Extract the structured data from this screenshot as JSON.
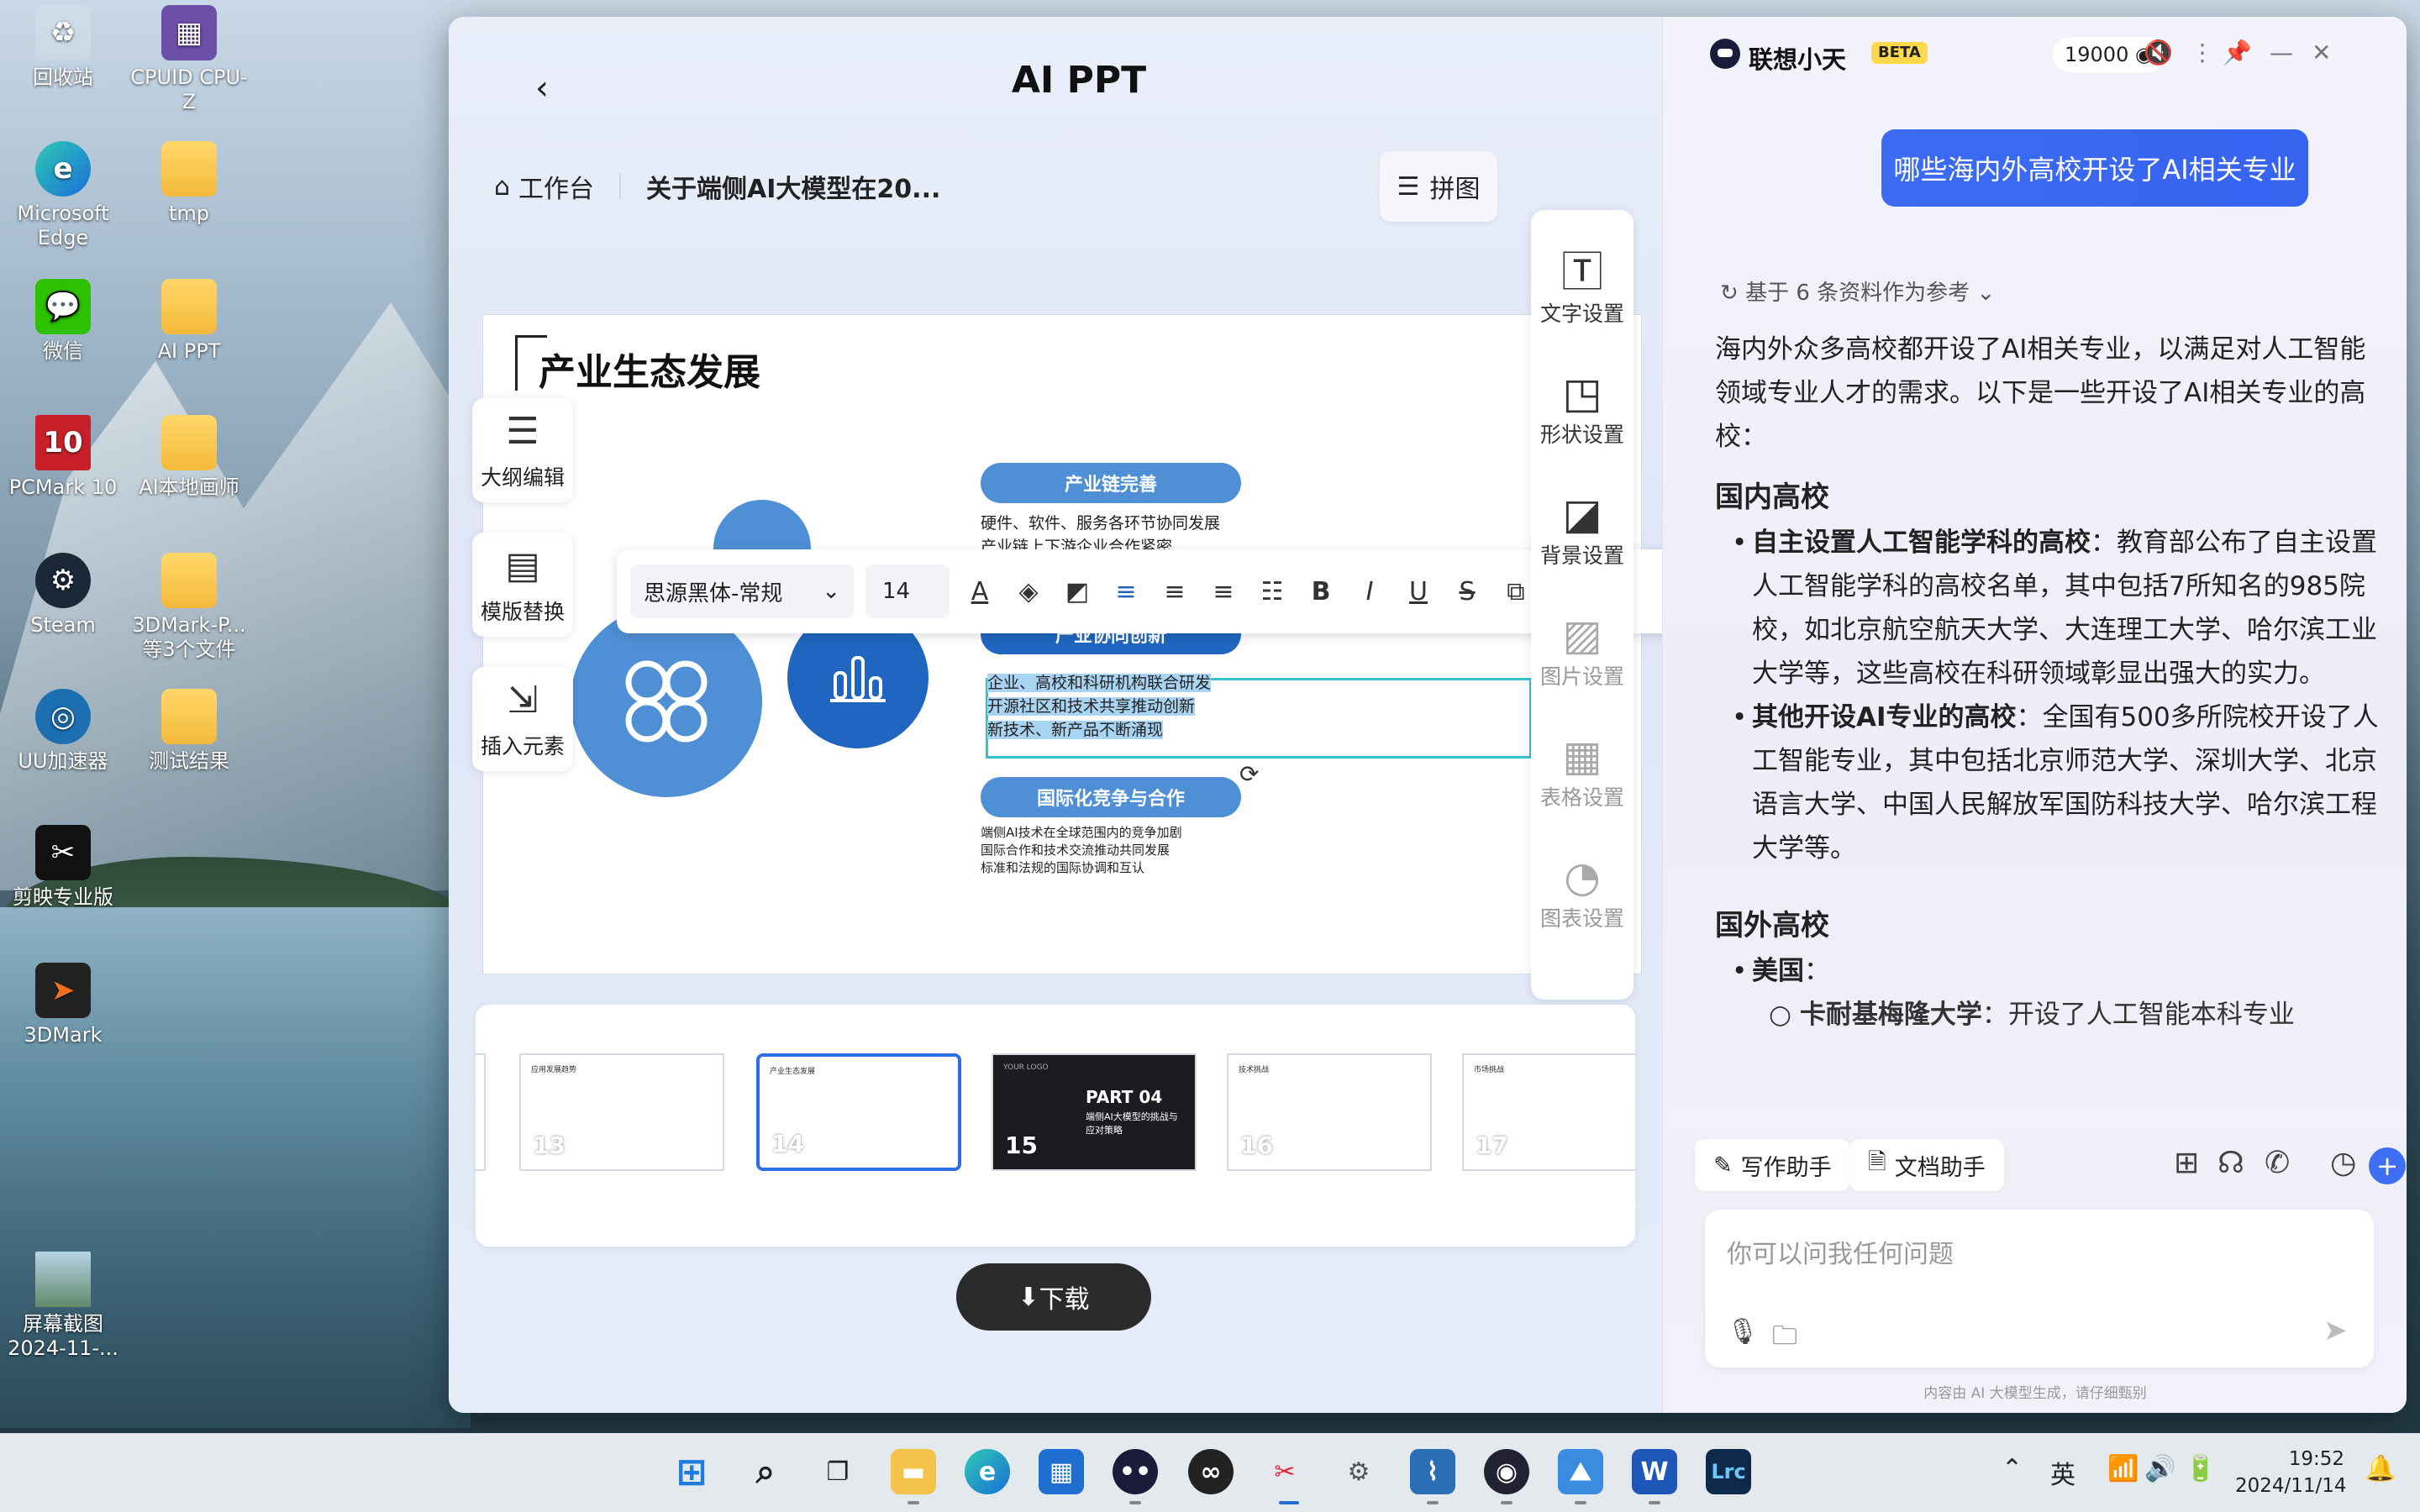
{
  "desktop": {
    "icons": [
      {
        "label": "回收站"
      },
      {
        "label": "CPUID CPU-Z"
      },
      {
        "label": "Microsoft Edge"
      },
      {
        "label": "tmp"
      },
      {
        "label": "微信"
      },
      {
        "label": "AI PPT"
      },
      {
        "label": "PCMark 10"
      },
      {
        "label": "AI本地画师"
      },
      {
        "label": "Steam"
      },
      {
        "label": "3DMark-P... 等3个文件"
      },
      {
        "label": "UU加速器"
      },
      {
        "label": "测试结果"
      },
      {
        "label": "剪映专业版"
      },
      {
        "label": "3DMark"
      },
      {
        "label": "屏幕截图 2024-11-..."
      }
    ]
  },
  "ppt": {
    "title": "AI PPT",
    "breadcrumb_home": "工作台",
    "breadcrumb_doc": "关于端侧AI大模型在20...",
    "collage_label": "拼图",
    "slide": {
      "title": "产业生态发展",
      "pill1": "产业链完善",
      "pill1_lines": [
        "硬件、软件、服务各环节协同发展",
        "产业链上下游企业合作紧密"
      ],
      "pill2": "产业协同创新",
      "pill2_lines": [
        "企业、高校和科研机构联合研发",
        "开源社区和技术共享推动创新",
        "新技术、新产品不断涌现"
      ],
      "pill3": "国际化竞争与合作",
      "pill3_lines": [
        "端侧AI技术在全球范围内的竞争加剧",
        "国际合作和技术交流推动共同发展",
        "标准和法规的国际协调和互认"
      ]
    },
    "left_tools": [
      "大纲编辑",
      "模版替换",
      "插入元素"
    ],
    "toolbar": {
      "font": "思源黑体-常规",
      "size": "14"
    },
    "right_tools": [
      "文字设置",
      "形状设置",
      "背景设置",
      "图片设置",
      "表格设置",
      "图表设置"
    ],
    "thumbnails": [
      {
        "num": "13",
        "mini": "应用发展趋势"
      },
      {
        "num": "14",
        "mini": "产业生态发展"
      },
      {
        "num": "15",
        "title": "PART 04",
        "sub": "端侧AI大模型的挑战与应对策略",
        "logo": "YOUR LOGO"
      },
      {
        "num": "16",
        "mini": "技术挑战"
      },
      {
        "num": "17",
        "mini": "市场挑战"
      }
    ],
    "download_label": "下载"
  },
  "ai": {
    "name": "联想小天",
    "beta": "BETA",
    "points": "19000",
    "user_message": "哪些海内外高校开设了AI相关专业",
    "ref_text": "基于 6 条资料作为参考",
    "intro": "海内外众多高校都开设了AI相关专业，以满足对人工智能领域专业人才的需求。以下是一些开设了AI相关专业的高校：",
    "domestic_title": "国内高校",
    "domestic_1_bold": "自主设置人工智能学科的高校",
    "domestic_1_text": "：教育部公布了自主设置人工智能学科的高校名单，其中包括7所知名的985院校，如北京航空航天大学、大连理工大学、哈尔滨工业大学等，这些高校在科研领域彰显出强大的实力。",
    "domestic_2_bold": "其他开设AI专业的高校",
    "domestic_2_text": "：全国有500多所院校开设了人工智能专业，其中包括北京师范大学、深圳大学、北京语言大学、中国人民解放军国防科技大学、哈尔滨工程大学等。",
    "foreign_title": "国外高校",
    "foreign_1_bold": "美国",
    "foreign_1_text": "：",
    "foreign_sub_bold": "卡耐基梅隆大学",
    "foreign_sub_text": "：开设了人工智能本科专业",
    "chip_write": "写作助手",
    "chip_doc": "文档助手",
    "input_placeholder": "你可以问我任何问题",
    "disclaimer": "内容由 AI 大模型生成，请仔细甄别"
  },
  "taskbar": {
    "ime": "英",
    "time": "19:52",
    "date": "2024/11/14"
  }
}
